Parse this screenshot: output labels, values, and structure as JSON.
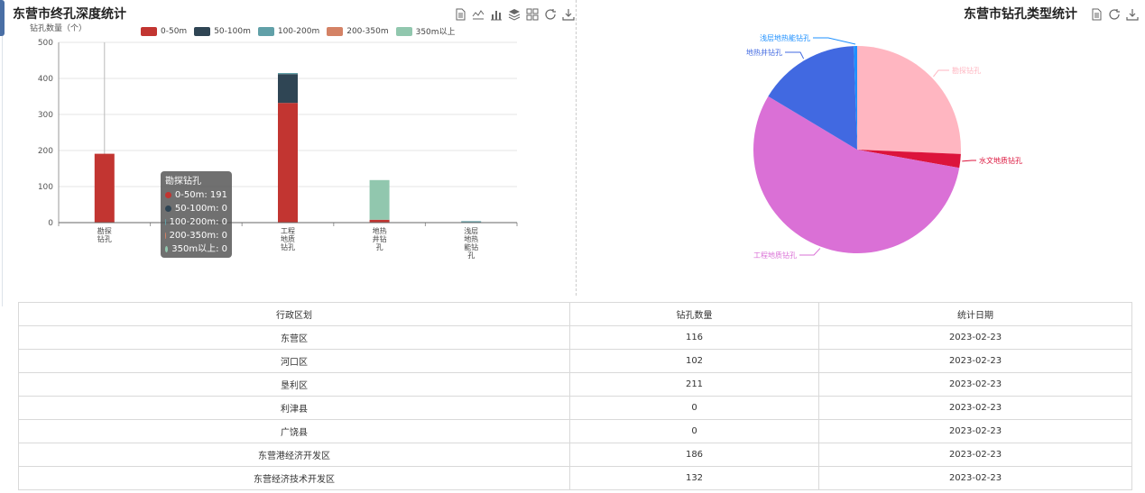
{
  "left_panel": {
    "title": "东营市终孔深度统计"
  },
  "right_panel": {
    "title": "东营市钻孔类型统计"
  },
  "bar_chart": {
    "y_axis_label": "钻孔数量（个）",
    "tooltip": {
      "title": "勘探钻孔",
      "rows": [
        "0-50m: 191",
        "50-100m: 0",
        "100-200m: 0",
        "200-350m: 0",
        "350m以上: 0"
      ]
    }
  },
  "chart_data": [
    {
      "type": "bar",
      "stacked": true,
      "title": "东营市终孔深度统计",
      "ylabel": "钻孔数量（个）",
      "ylim": [
        0,
        500
      ],
      "yticks": [
        0,
        100,
        200,
        300,
        400,
        500
      ],
      "categories": [
        "勘探钻孔",
        "",
        "工程地质钻孔",
        "地热井钻孔",
        "浅层地热能钻孔"
      ],
      "category_lines": [
        [
          "勘探",
          "钻孔"
        ],
        [],
        [
          "工程",
          "地质",
          "钻孔"
        ],
        [
          "地热",
          "井钻",
          "孔"
        ],
        [
          "浅层",
          "地热",
          "能钻",
          "孔"
        ]
      ],
      "grid": true,
      "legend_position": "top",
      "series": [
        {
          "name": "0-50m",
          "color": "#c23531",
          "values": [
            191,
            0,
            332,
            8,
            0
          ]
        },
        {
          "name": "50-100m",
          "color": "#2f4554",
          "values": [
            0,
            0,
            80,
            0,
            0
          ]
        },
        {
          "name": "100-200m",
          "color": "#61a0a8",
          "values": [
            0,
            0,
            3,
            0,
            4
          ]
        },
        {
          "name": "200-350m",
          "color": "#d48265",
          "values": [
            0,
            0,
            0,
            0,
            0
          ]
        },
        {
          "name": "350m以上",
          "color": "#91c7ae",
          "values": [
            0,
            0,
            0,
            110,
            0
          ]
        }
      ]
    },
    {
      "type": "pie",
      "title": "东营市钻孔类型统计",
      "slices": [
        {
          "name": "勘探钻孔",
          "value": 191,
          "color": "#ffb6c1"
        },
        {
          "name": "水文地质钻孔",
          "value": 16,
          "color": "#dc143c"
        },
        {
          "name": "工程地质钻孔",
          "value": 415,
          "color": "#da70d6"
        },
        {
          "name": "地热井钻孔",
          "value": 118,
          "color": "#4169e1"
        },
        {
          "name": "浅层地热能钻孔",
          "value": 4,
          "color": "#1e90ff"
        }
      ]
    }
  ],
  "table": {
    "headers": [
      "行政区划",
      "钻孔数量",
      "统计日期"
    ],
    "rows": [
      [
        "东营区",
        "116",
        "2023-02-23"
      ],
      [
        "河口区",
        "102",
        "2023-02-23"
      ],
      [
        "垦利区",
        "211",
        "2023-02-23"
      ],
      [
        "利津县",
        "0",
        "2023-02-23"
      ],
      [
        "广饶县",
        "0",
        "2023-02-23"
      ],
      [
        "东营港经济开发区",
        "186",
        "2023-02-23"
      ],
      [
        "东营经济技术开发区",
        "132",
        "2023-02-23"
      ]
    ]
  }
}
